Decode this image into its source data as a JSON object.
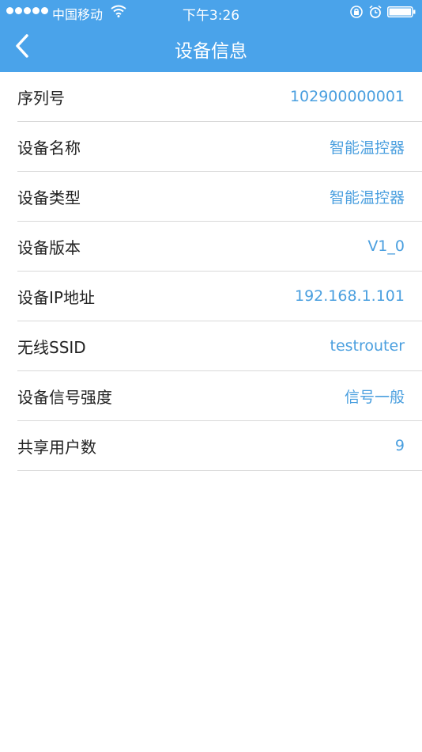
{
  "status_bar": {
    "carrier": "中国移动",
    "time": "下午3:26"
  },
  "header": {
    "title": "设备信息"
  },
  "colors": {
    "header_bg": "#4aa3ea",
    "value_text": "#4a9fdf",
    "label_text": "#222222"
  },
  "icons": {
    "back": "chevron-left-icon",
    "wifi": "wifi-icon",
    "orientation_lock": "lock-rotation-icon",
    "alarm": "alarm-icon",
    "battery": "battery-icon"
  },
  "rows": [
    {
      "label": "序列号",
      "value": "102900000001"
    },
    {
      "label": "设备名称",
      "value": "智能温控器"
    },
    {
      "label": "设备类型",
      "value": "智能温控器"
    },
    {
      "label": "设备版本",
      "value": "V1_0"
    },
    {
      "label": "设备IP地址",
      "value": "192.168.1.101"
    },
    {
      "label": "无线SSID",
      "value": "testrouter"
    },
    {
      "label": "设备信号强度",
      "value": "信号一般"
    },
    {
      "label": "共享用户数",
      "value": "9"
    }
  ]
}
